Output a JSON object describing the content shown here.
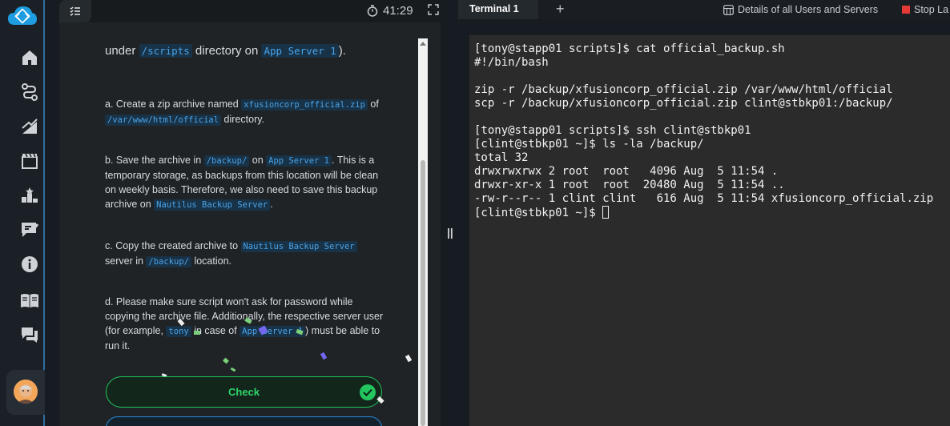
{
  "task": {
    "timer": "41:29",
    "intro": {
      "t1": "under ",
      "c1": "/scripts",
      "t2": " directory on ",
      "c2": "App Server 1",
      "t3": ")."
    },
    "step_a": {
      "t1": "a. Create a zip archive named ",
      "c1": "xfusioncorp_official.zip",
      "t2": " of ",
      "c2": "/var/www/html/official",
      "t3": " directory."
    },
    "step_b": {
      "t1": "b. Save the archive in ",
      "c1": "/backup/",
      "t2": " on ",
      "c2": "App Server 1",
      "t3": ". This is a temporary storage, as backups from this location will be clean on weekly basis. Therefore, we also need to save this backup archive on ",
      "c3": "Nautilus Backup Server",
      "t4": "."
    },
    "step_c": {
      "t1": "c. Copy the created archive to ",
      "c1": "Nautilus Backup Server",
      "t2": " server in ",
      "c2": "/backup/",
      "t3": " location."
    },
    "step_d": {
      "t1": "d. Please make sure script won't ask for password while copying the archive file. Additionally, the respective server user (for example, ",
      "c1": "tony",
      "t2": " in case of ",
      "c2": "App Server 1",
      "t3": ") must be able to run it."
    },
    "check_label": "Check"
  },
  "terminal": {
    "tab_label": "Terminal 1",
    "add_tab": "+",
    "details_label": "Details of all Users and Servers",
    "stop_label": "Stop La",
    "lines": [
      "[tony@stapp01 scripts]$ cat official_backup.sh",
      "#!/bin/bash",
      "",
      "zip -r /backup/xfusioncorp_official.zip /var/www/html/official",
      "scp -r /backup/xfusioncorp_official.zip clint@stbkp01:/backup/",
      "",
      "[tony@stapp01 scripts]$ ssh clint@stbkp01",
      "[clint@stbkp01 ~]$ ls -la /backup/",
      "total 32",
      "drwxrwxrwx 2 root  root   4096 Aug  5 11:54 .",
      "drwxr-xr-x 1 root  root  20480 Aug  5 11:54 ..",
      "-rw-r--r-- 1 clint clint   616 Aug  5 11:54 xfusioncorp_official.zip"
    ],
    "prompt": "[clint@stbkp01 ~]$ "
  },
  "colors": {
    "accent": "#22c55e",
    "code": "#4aa3e8",
    "stop": "#e53935"
  }
}
